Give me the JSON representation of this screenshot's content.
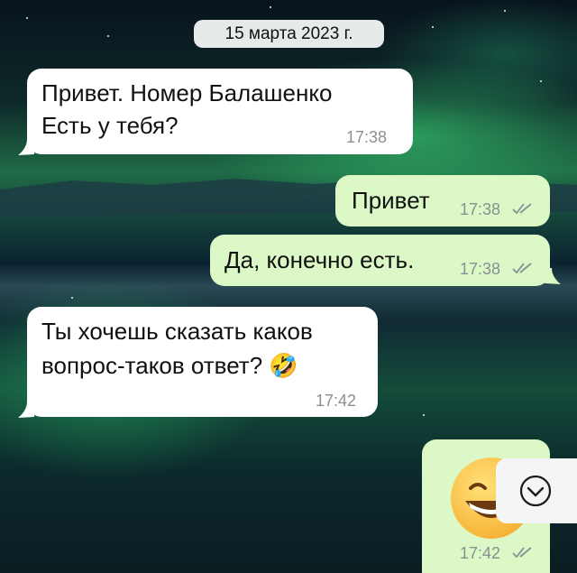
{
  "date_pill": "15 марта 2023 г.",
  "messages": [
    {
      "direction": "incoming",
      "lines": [
        "Привет. Номер Балашенко",
        "Есть у тебя?"
      ],
      "time": "17:38"
    },
    {
      "direction": "outgoing",
      "text": "Привет",
      "time": "17:38",
      "status": "read"
    },
    {
      "direction": "outgoing",
      "text": "Да, конечно есть.",
      "time": "17:38",
      "status": "read"
    },
    {
      "direction": "incoming",
      "lines": [
        "Ты хочешь сказать каков",
        "вопрос-таков ответ? 🤣"
      ],
      "time": "17:42"
    },
    {
      "direction": "outgoing",
      "emoji": "grinning-face-with-smiling-eyes",
      "time": "17:42",
      "status": "read"
    }
  ],
  "colors": {
    "incoming": "#ffffff",
    "outgoing": "#dcf8c6",
    "read_ticks": "#8a8f93"
  },
  "icons": {
    "scroll_down": "chevron-down-circle-icon",
    "read_receipt": "double-check-icon"
  }
}
